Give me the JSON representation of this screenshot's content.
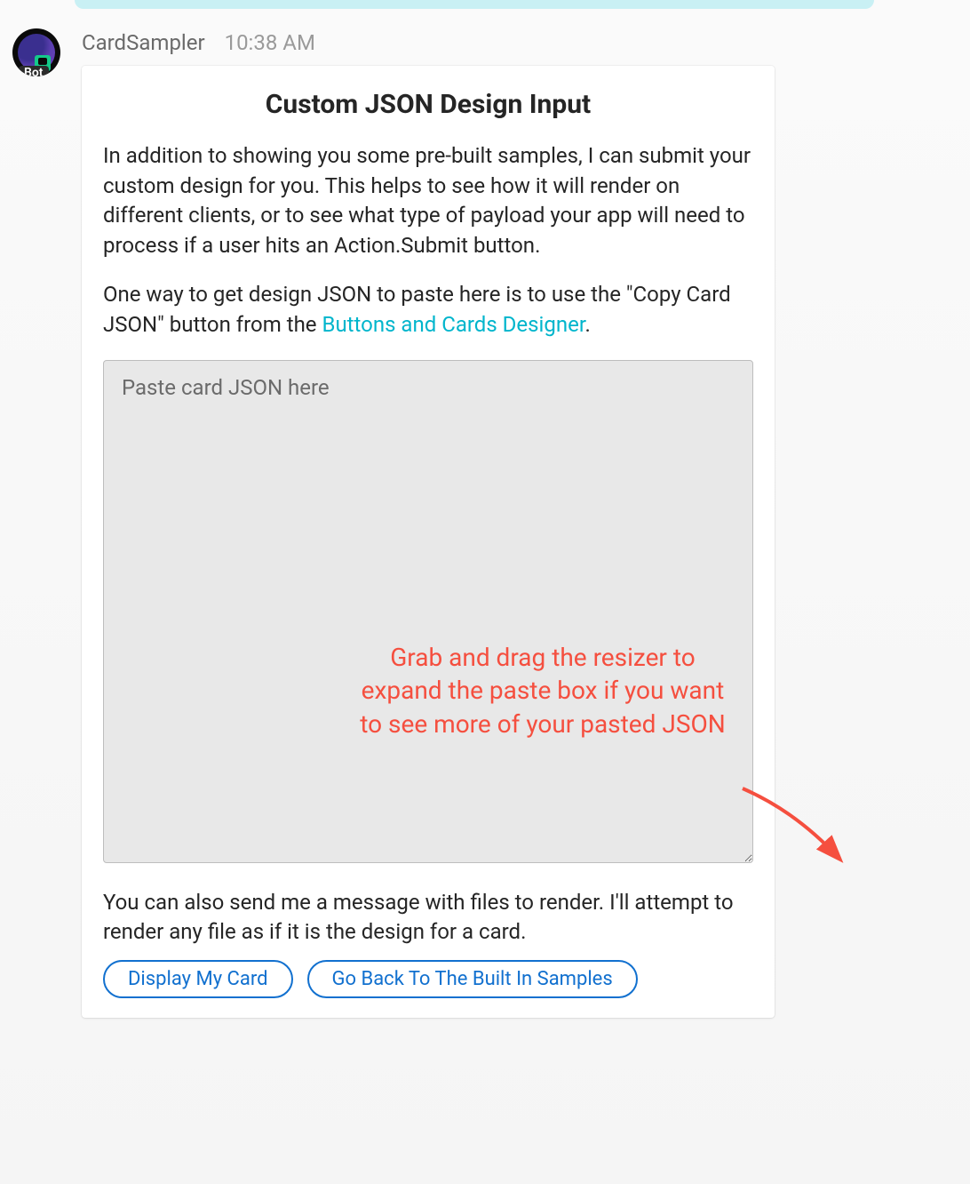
{
  "message": {
    "sender": "CardSampler",
    "timestamp": "10:38 AM",
    "bot_badge": "Bot"
  },
  "card": {
    "title": "Custom JSON Design Input",
    "p1": "In addition to showing you some pre-built samples, I can submit your custom design for you.  This helps to see how it will render on different clients, or to see what type of payload your app will need to process if a user hits an Action.Submit button.",
    "p2_prefix": "One way to get design JSON to paste here is to use the \"Copy Card JSON\" button from the ",
    "p2_link": "Buttons and Cards Designer",
    "p2_suffix": ".",
    "textarea_placeholder": "Paste card JSON here",
    "annotation": "Grab and drag the resizer to expand the paste box if you want to see more of your pasted JSON",
    "p3": "You can also send me a message with files to render.  I'll attempt to render any file as if it is the design for a card.",
    "actions": {
      "display": "Display My Card",
      "goback": "Go Back To The Built In Samples"
    }
  }
}
